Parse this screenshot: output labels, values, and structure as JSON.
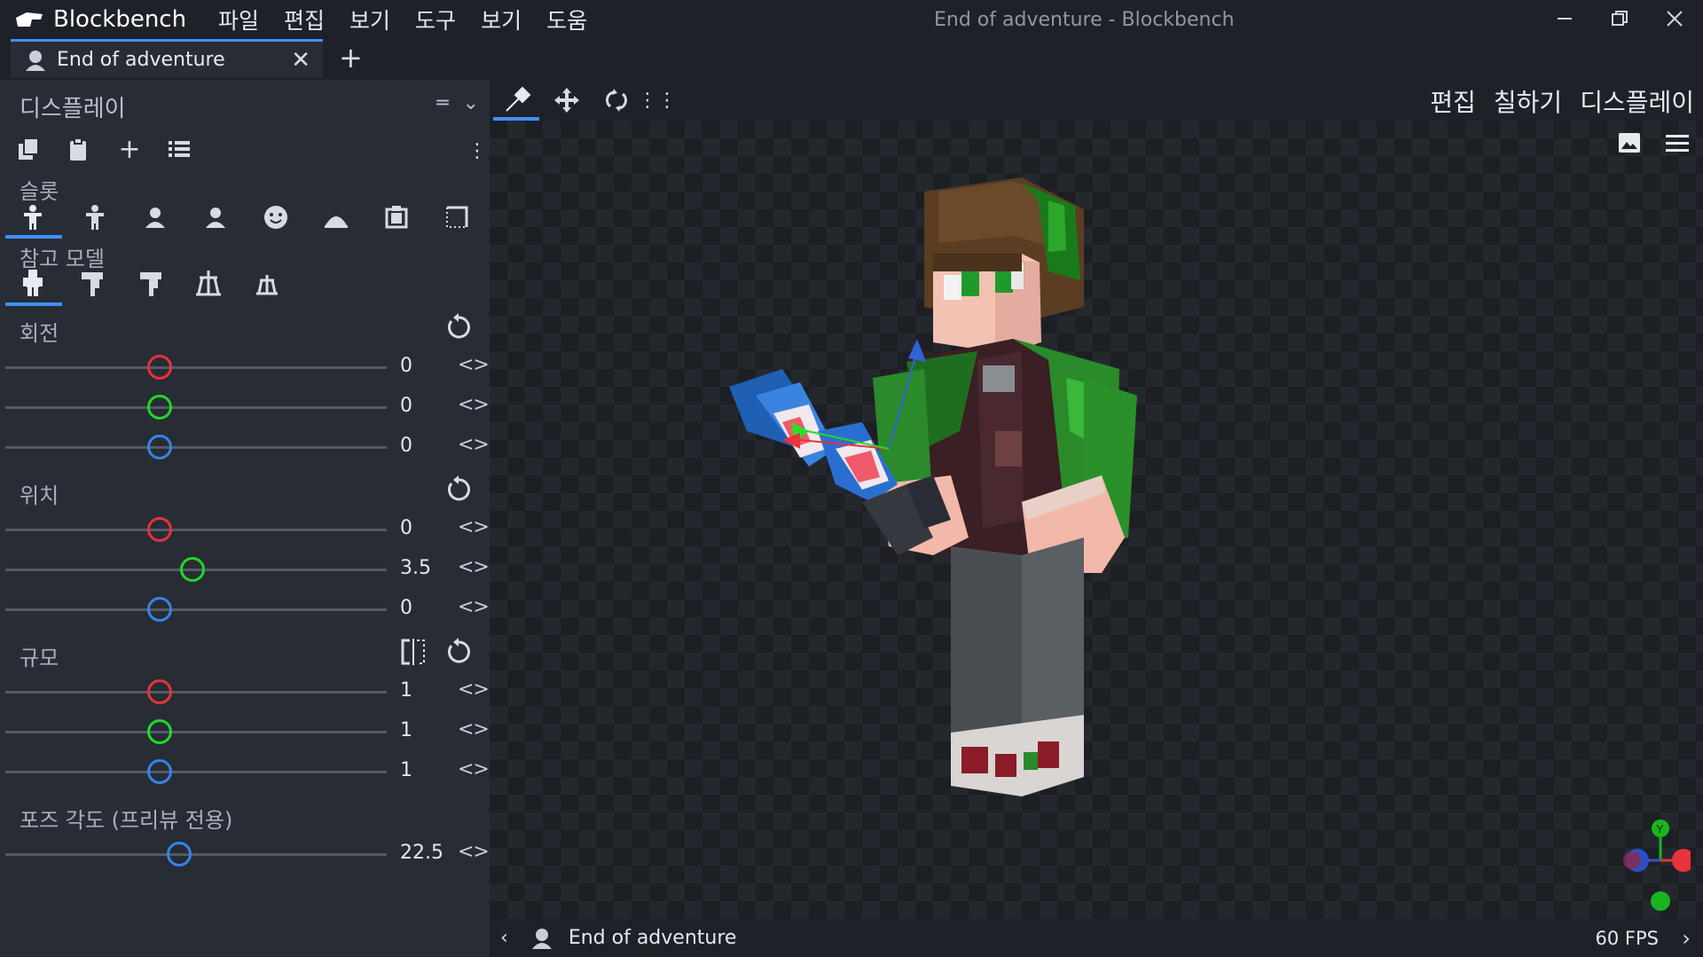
{
  "app": {
    "name": "Blockbench",
    "window_title": "End of adventure - Blockbench"
  },
  "menu": [
    "파일",
    "편집",
    "보기",
    "도구",
    "보기",
    "도움"
  ],
  "tab": {
    "label": "End of adventure"
  },
  "panel": {
    "title": "디스플레이",
    "slot_label": "슬롯",
    "ref_label": "참고 모델",
    "rotation": {
      "label": "회전",
      "values": [
        "0",
        "0",
        "0"
      ],
      "fractions": [
        0.405,
        0.405,
        0.405
      ]
    },
    "position": {
      "label": "위치",
      "values": [
        "0",
        "3.5",
        "0"
      ],
      "fractions": [
        0.405,
        0.491,
        0.405
      ]
    },
    "scale": {
      "label": "규모",
      "values": [
        "1",
        "1",
        "1"
      ],
      "fractions": [
        0.405,
        0.405,
        0.405
      ]
    },
    "pose": {
      "label": "포즈 각도 (프리뷰 전용)",
      "value": "22.5",
      "fraction": 0.455
    }
  },
  "modes": [
    "편집",
    "칠하기",
    "디스플레이"
  ],
  "status": {
    "model_name": "End of adventure",
    "fps": "60 FPS"
  },
  "colors": {
    "accent": "#3e90ff",
    "x_axis": "#e8323c",
    "y_axis": "#1ed829",
    "z_axis": "#3285e8"
  }
}
